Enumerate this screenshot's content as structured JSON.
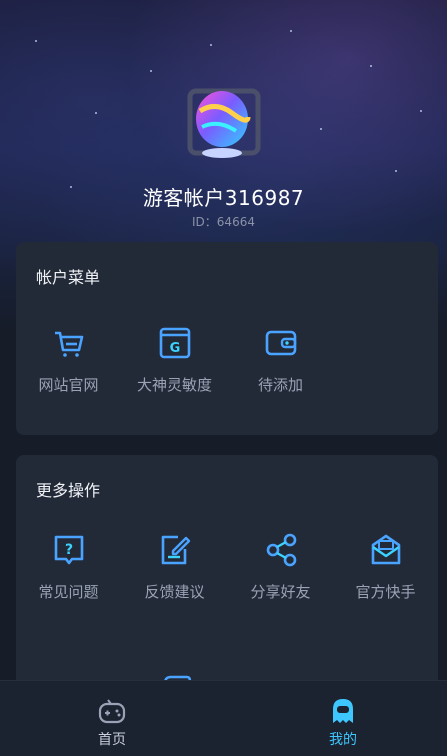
{
  "profile": {
    "account_name": "游客帐户316987",
    "account_id": "ID：64664"
  },
  "account_menu": {
    "title": "帐户菜单",
    "items": [
      {
        "label": "网站官网",
        "icon": "cart-icon"
      },
      {
        "label": "大神灵敏度",
        "icon": "g-window-icon"
      },
      {
        "label": "待添加",
        "icon": "wallet-icon"
      }
    ]
  },
  "more_actions": {
    "title": "更多操作",
    "items": [
      {
        "label": "常见问题",
        "icon": "question-icon"
      },
      {
        "label": "反馈建议",
        "icon": "edit-note-icon"
      },
      {
        "label": "分享好友",
        "icon": "share-icon"
      },
      {
        "label": "官方快手",
        "icon": "mail-icon"
      }
    ]
  },
  "bottom_nav": {
    "home_label": "首页",
    "mine_label": "我的"
  },
  "colors": {
    "accent": "#4aa3ff",
    "active_tab": "#3ec7ff",
    "card_bg": "#222a38",
    "page_bg": "#161c28"
  }
}
